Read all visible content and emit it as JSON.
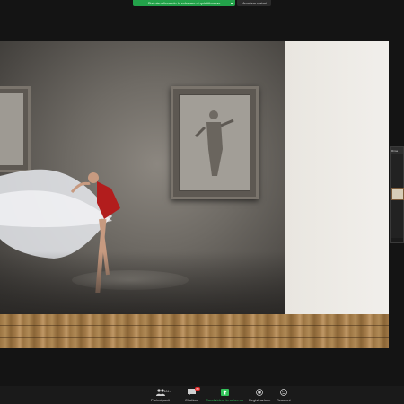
{
  "banner": {
    "share_text": "Stai visualizzando lo schermo di quintithomas",
    "view_options": "Visualizza opzioni"
  },
  "side_thumb": {
    "header": "Rima"
  },
  "toolbar": {
    "participants_label": "Partecipanti",
    "participants_count": "104",
    "chat_label": "Chattare",
    "chat_badge": "80",
    "share_label": "Condividere lo schermo",
    "record_label": "Registrazione",
    "reactions_label": "Reazioni"
  },
  "colors": {
    "share_green": "#23a24a",
    "toolbar_bg": "#1a1a1a",
    "badge_red": "#e02828"
  }
}
